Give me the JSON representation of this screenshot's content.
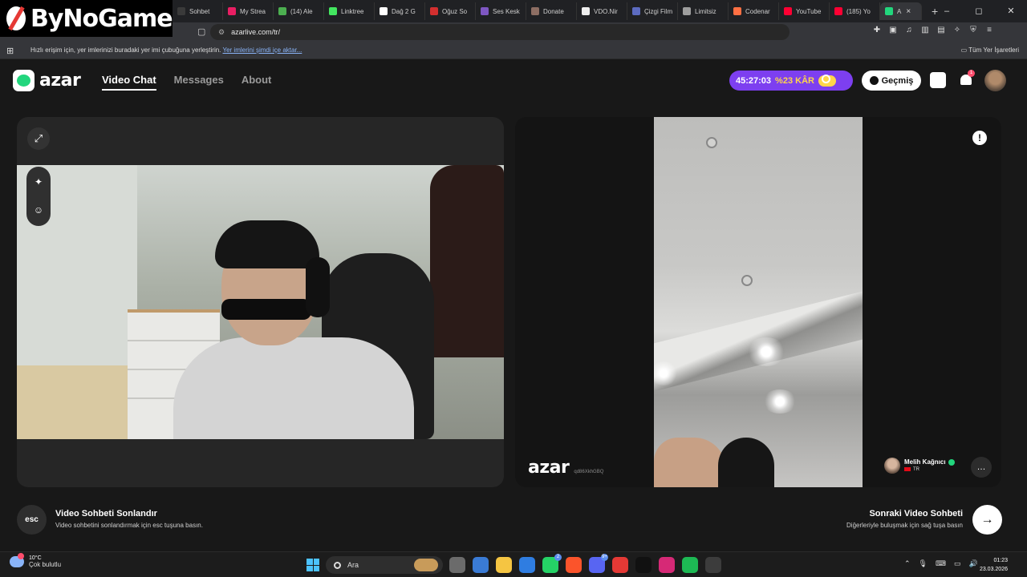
{
  "browser": {
    "tabs": [
      {
        "label": "Sohbet",
        "color": "#3a3a3a"
      },
      {
        "label": "My Strea",
        "color": "#e91e63"
      },
      {
        "label": "(14) Ale",
        "color": "#4caf50"
      },
      {
        "label": "Linktree",
        "color": "#43e660"
      },
      {
        "label": "Dağ 2 G",
        "color": "#ffffff"
      },
      {
        "label": "Oğuz So",
        "color": "#d32f2f"
      },
      {
        "label": "Ses Kesk",
        "color": "#7e57c2"
      },
      {
        "label": "Donate",
        "color": "#8d6e63"
      },
      {
        "label": "VDO.Nir",
        "color": "#eeeeee"
      },
      {
        "label": "Çizgi Film",
        "color": "#5c6bc0"
      },
      {
        "label": "Limitsiz",
        "color": "#9e9e9e"
      },
      {
        "label": "Codenar",
        "color": "#ff7043"
      },
      {
        "label": "YouTube",
        "color": "#ff0033"
      },
      {
        "label": "(185) Yo",
        "color": "#ff0033"
      }
    ],
    "active_tab": {
      "label": "A",
      "color": "#22d67d"
    },
    "close_label": "×",
    "new_tab_label": "+",
    "window": {
      "minimize": "–",
      "maximize": "◻",
      "close": "✕"
    },
    "url": "azarlive.com/tr/",
    "bookmark_hint": "Hızlı erişim için, yer imlerinizi buradaki yer imi çubuğuna yerleştirin.",
    "bookmark_import": "Yer imlerini şimdi içe aktar...",
    "all_bookmarks": "Tüm Yer İşaretleri"
  },
  "overlay": {
    "brand": "ByNoGame"
  },
  "azar": {
    "logo": "azar",
    "nav": [
      "Video Chat",
      "Messages",
      "About"
    ],
    "timer": "45:27:03",
    "kar": "%23 KÂR",
    "history_label": "Geçmiş",
    "notification_count": "1",
    "watermark": "azar",
    "match_id": "qd86XkhGBQ",
    "partner_name": "Melih Kağnıcı",
    "partner_country": "TR",
    "esc_key": "esc",
    "end_title": "Video Sohbeti Sonlandır",
    "end_sub": "Video sohbetini sonlandırmak için esc tuşuna basın.",
    "next_title": "Sonraki Video Sohbeti",
    "next_sub": "Diğerleriyle buluşmak için sağ tuşa basın",
    "next_glyph": "→",
    "expand_glyph": "⤢",
    "effects_glyph": "✦",
    "sticker_glyph": "☺",
    "report_glyph": "!",
    "chat_glyph": "…"
  },
  "taskbar": {
    "temp": "10°C",
    "condition": "Çok bulutlu",
    "search": "Ara",
    "time": "01:23",
    "date": "23.03.2026",
    "tray_icons": [
      "⌃",
      "🎙",
      "⌨",
      "▭",
      "🔊"
    ],
    "apps": [
      {
        "name": "file-explorer",
        "color": "#6b6b6b"
      },
      {
        "name": "store",
        "color": "#3a7bd5"
      },
      {
        "name": "folder",
        "color": "#f5c542"
      },
      {
        "name": "mail",
        "color": "#2f7de1"
      },
      {
        "name": "whatsapp",
        "color": "#25d366",
        "badge": "2"
      },
      {
        "name": "brave",
        "color": "#fb542b"
      },
      {
        "name": "discord",
        "color": "#5865f2",
        "badge": "9+"
      },
      {
        "name": "app-red",
        "color": "#e53935"
      },
      {
        "name": "tiktok",
        "color": "#111111"
      },
      {
        "name": "instagram",
        "color": "#d62976"
      },
      {
        "name": "spotify",
        "color": "#1db954"
      },
      {
        "name": "obs",
        "color": "#3c3c3c"
      }
    ]
  }
}
